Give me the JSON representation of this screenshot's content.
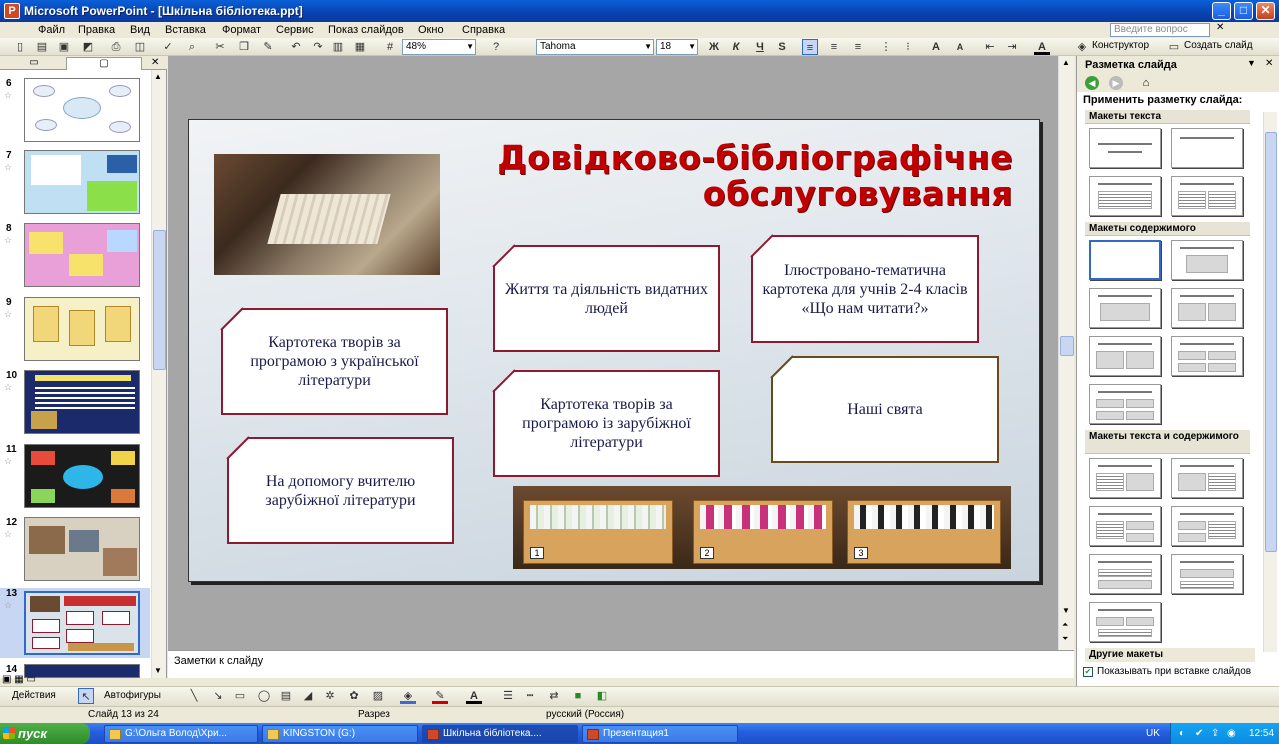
{
  "window": {
    "title": "Microsoft PowerPoint - [Шкільна бібліотека.ppt]",
    "btn_min": "_",
    "btn_max": "□",
    "btn_close": "✕"
  },
  "menu": {
    "items": [
      "Файл",
      "Правка",
      "Вид",
      "Вставка",
      "Формат",
      "Сервис",
      "Показ слайдов",
      "Окно",
      "Справка"
    ],
    "help_placeholder": "Введите вопрос"
  },
  "toolbar": {
    "zoom": "48%",
    "font": "Tahoma",
    "size": "18",
    "bold": "Ж",
    "italic": "К",
    "underline": "Ч",
    "shadow": "S",
    "designer": "Конструктор",
    "new_slide": "Создать слайд"
  },
  "slides_pane": {
    "tab1": "▭",
    "tab2": "▢",
    "close": "✕",
    "thumbs": [
      {
        "num": "6"
      },
      {
        "num": "7"
      },
      {
        "num": "8"
      },
      {
        "num": "9"
      },
      {
        "num": "10"
      },
      {
        "num": "11"
      },
      {
        "num": "12"
      },
      {
        "num": "13",
        "selected": true
      },
      {
        "num": "14"
      }
    ]
  },
  "slide": {
    "title": "Довідково-бібліографічне обслуговування",
    "boxes": {
      "b1": "Життя та діяльність видатних людей",
      "b2": "Ілюстровано-тематична картотека для учнів  2-4 класів «Що нам читати?»",
      "b3": "Картотека творів за програмою з української літератури",
      "b4": "Картотека творів за програмою із зарубіжної літератури",
      "b5": "Наші свята",
      "b6": "На допомогу вчителю зарубіжної літератури"
    },
    "tray_numbers": [
      "1",
      "2",
      "3"
    ]
  },
  "notes": {
    "placeholder": "Заметки к слайду"
  },
  "taskpane": {
    "title": "Разметка слайда",
    "apply_label": "Применить разметку слайда:",
    "sections": {
      "text": "Макеты текста",
      "content": "Макеты содержимого",
      "text_content": "Макеты текста и содержимого",
      "other": "Другие макеты"
    },
    "show_on_insert": "Показывать при вставке слайдов"
  },
  "drawbar": {
    "actions": "Действия",
    "autoshapes": "Автофигуры"
  },
  "status": {
    "slide": "Слайд 13 из 24",
    "design": "Разрез",
    "language": "русский (Россия)"
  },
  "taskbar": {
    "start": "пуск",
    "tasks": [
      "G:\\Ольга Волод\\Хри...",
      "KINGSTON (G:)",
      "Шкільна бібліотека....",
      "Презентация1"
    ],
    "lang": "UK",
    "time": "12:54"
  }
}
